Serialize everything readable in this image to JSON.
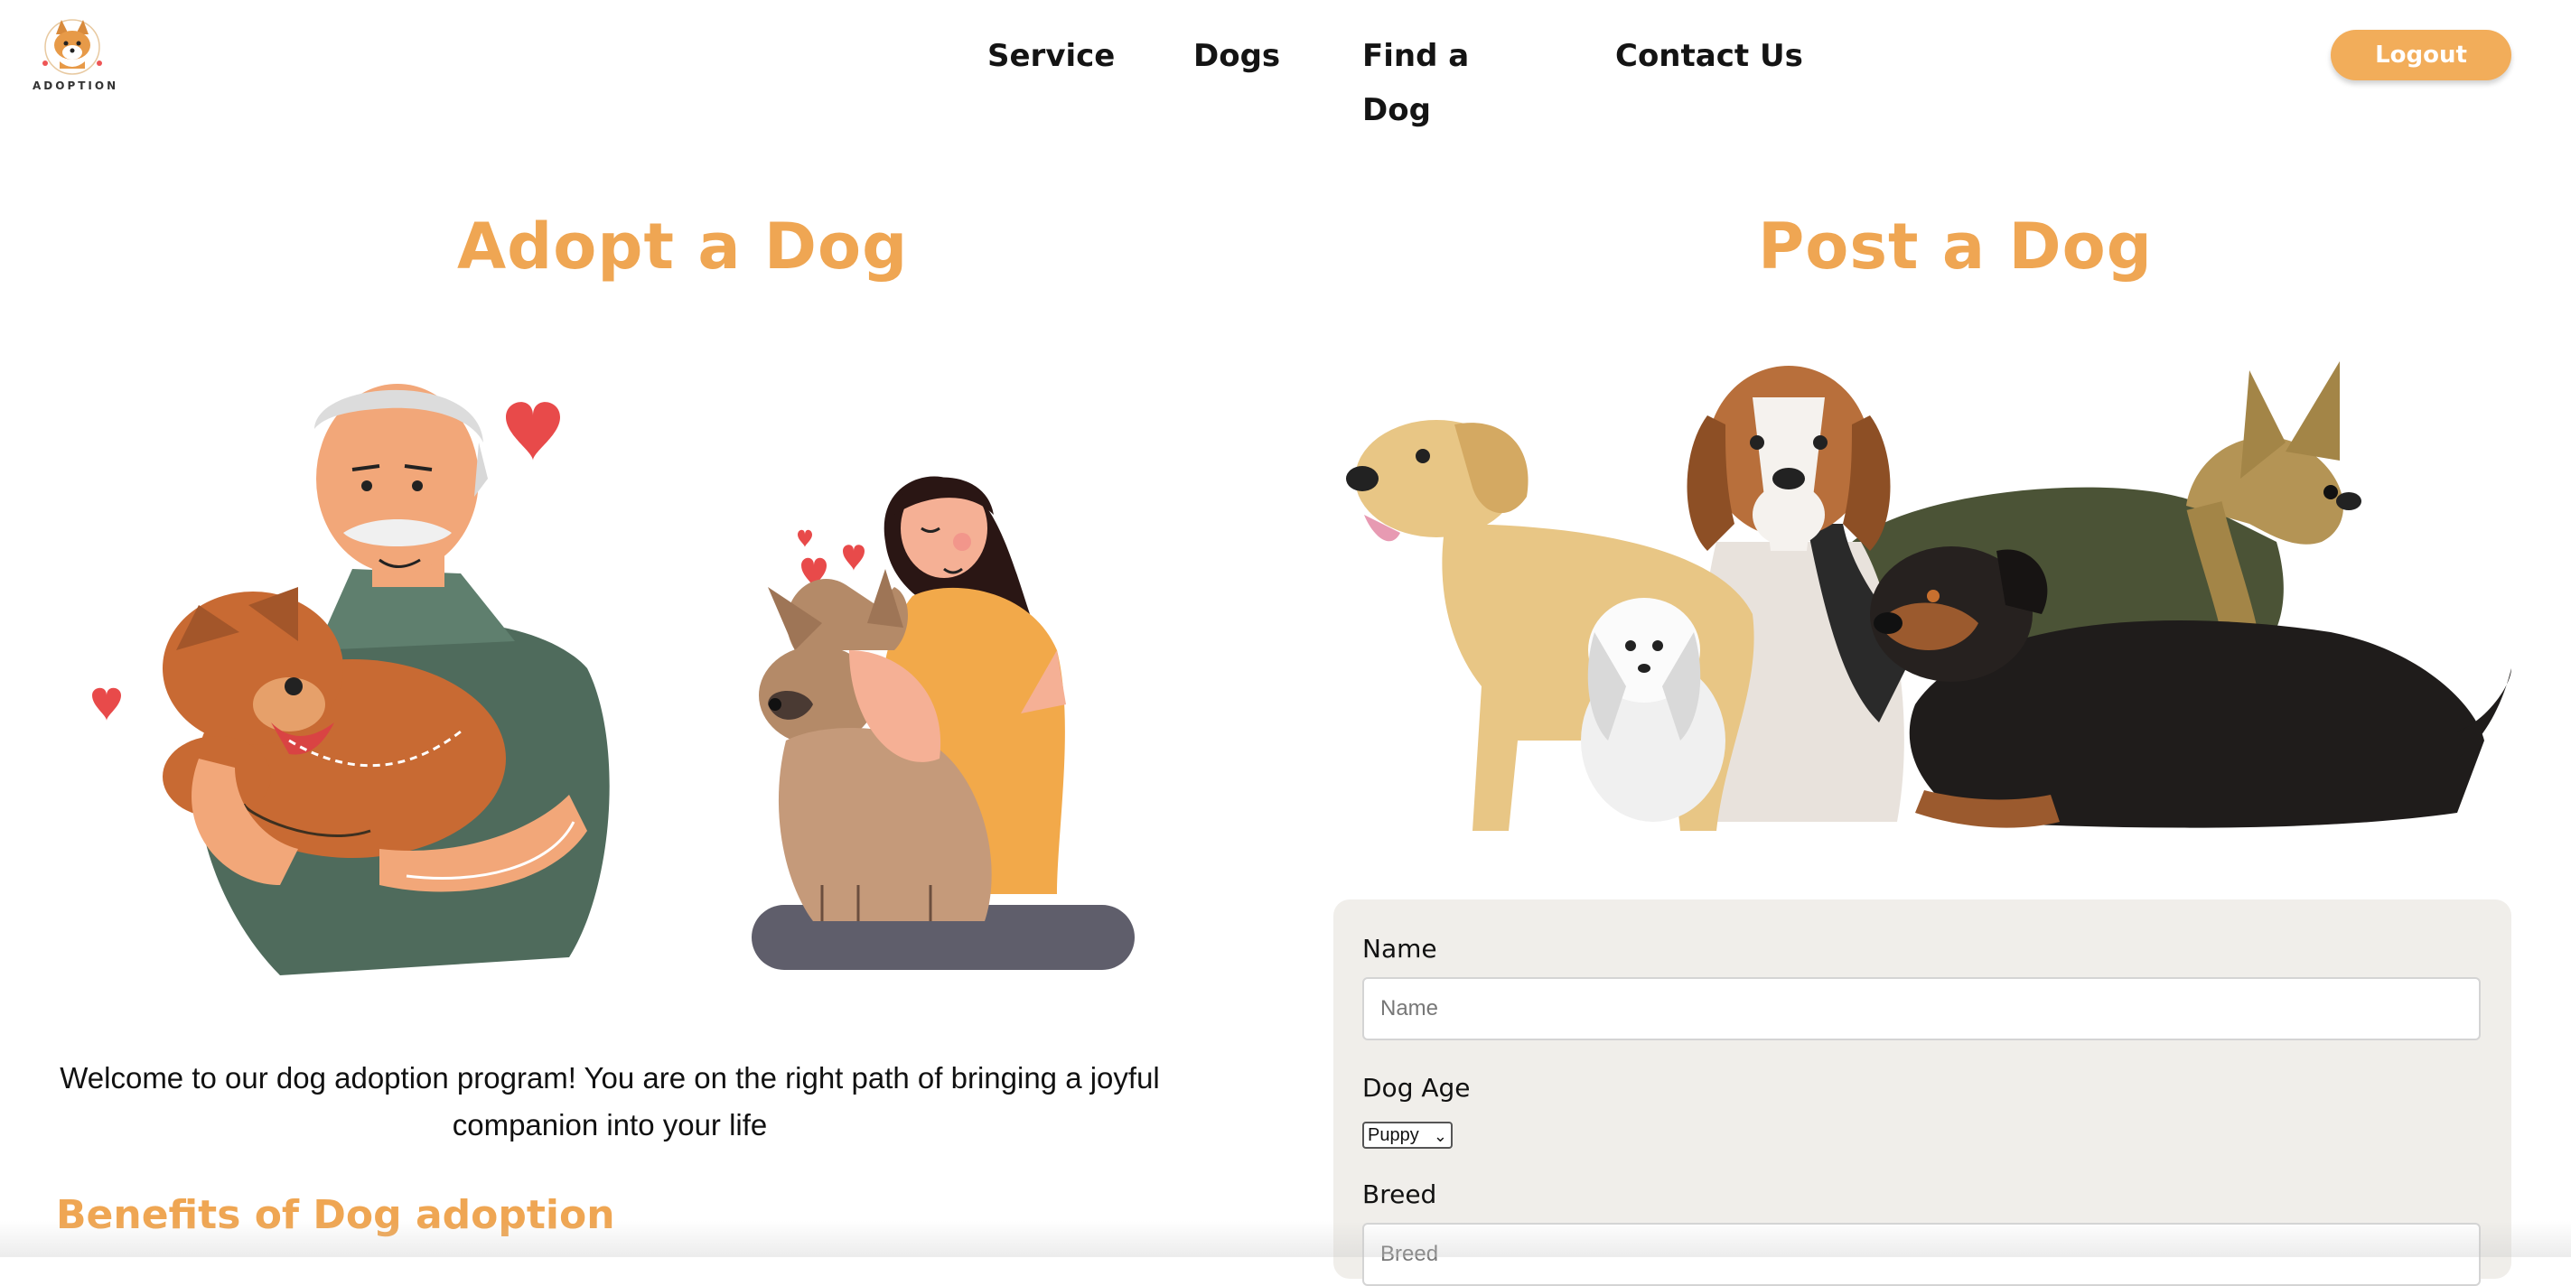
{
  "nav": {
    "logo_text": "ADOPTION",
    "links": [
      "Service",
      "Dogs",
      "Find a Dog",
      "Contact Us"
    ],
    "logout_label": "Logout"
  },
  "adopt": {
    "title": "Adopt a Dog",
    "welcome_text": "Welcome to our dog adoption program! You are on the right path of bringing a joyful companion into your life",
    "benefits_title": "Benefits of Dog adoption"
  },
  "post": {
    "title": "Post a Dog",
    "form": {
      "name_label": "Name",
      "name_placeholder": "Name",
      "age_label": "Dog Age",
      "age_selected": "Puppy",
      "breed_label": "Breed",
      "breed_placeholder": "Breed"
    }
  },
  "colors": {
    "accent": "#efa653",
    "button": "#f2ad5a",
    "form_bg": "#f0eeea"
  }
}
